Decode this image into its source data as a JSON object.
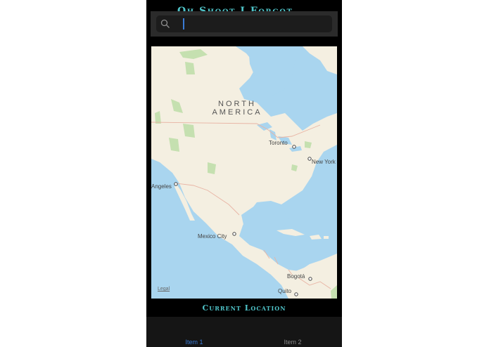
{
  "app": {
    "title": "Oh Shoot I Forgot ..."
  },
  "search": {
    "placeholder": "",
    "value": ""
  },
  "map": {
    "continent_label_line1": "NORTH",
    "continent_label_line2": "AMERICA",
    "cities": {
      "toronto": "Toronto",
      "new_york": "New York",
      "los_angeles": "Angeles",
      "mexico_city": "Mexico City",
      "bogota": "Bogotá",
      "quito": "Quito"
    },
    "legal": "Legal",
    "colors": {
      "water": "#a9d5ef",
      "land": "#f4efe1",
      "parks": "#c5e0b0",
      "borders": "#e8b4a4"
    }
  },
  "location_label": "Current Location",
  "tabs": [
    {
      "label": "Item 1",
      "selected": true
    },
    {
      "label": "Item 2",
      "selected": false
    }
  ],
  "colors": {
    "accent": "#4fc3c8",
    "tab_selected": "#3a7bd5"
  }
}
